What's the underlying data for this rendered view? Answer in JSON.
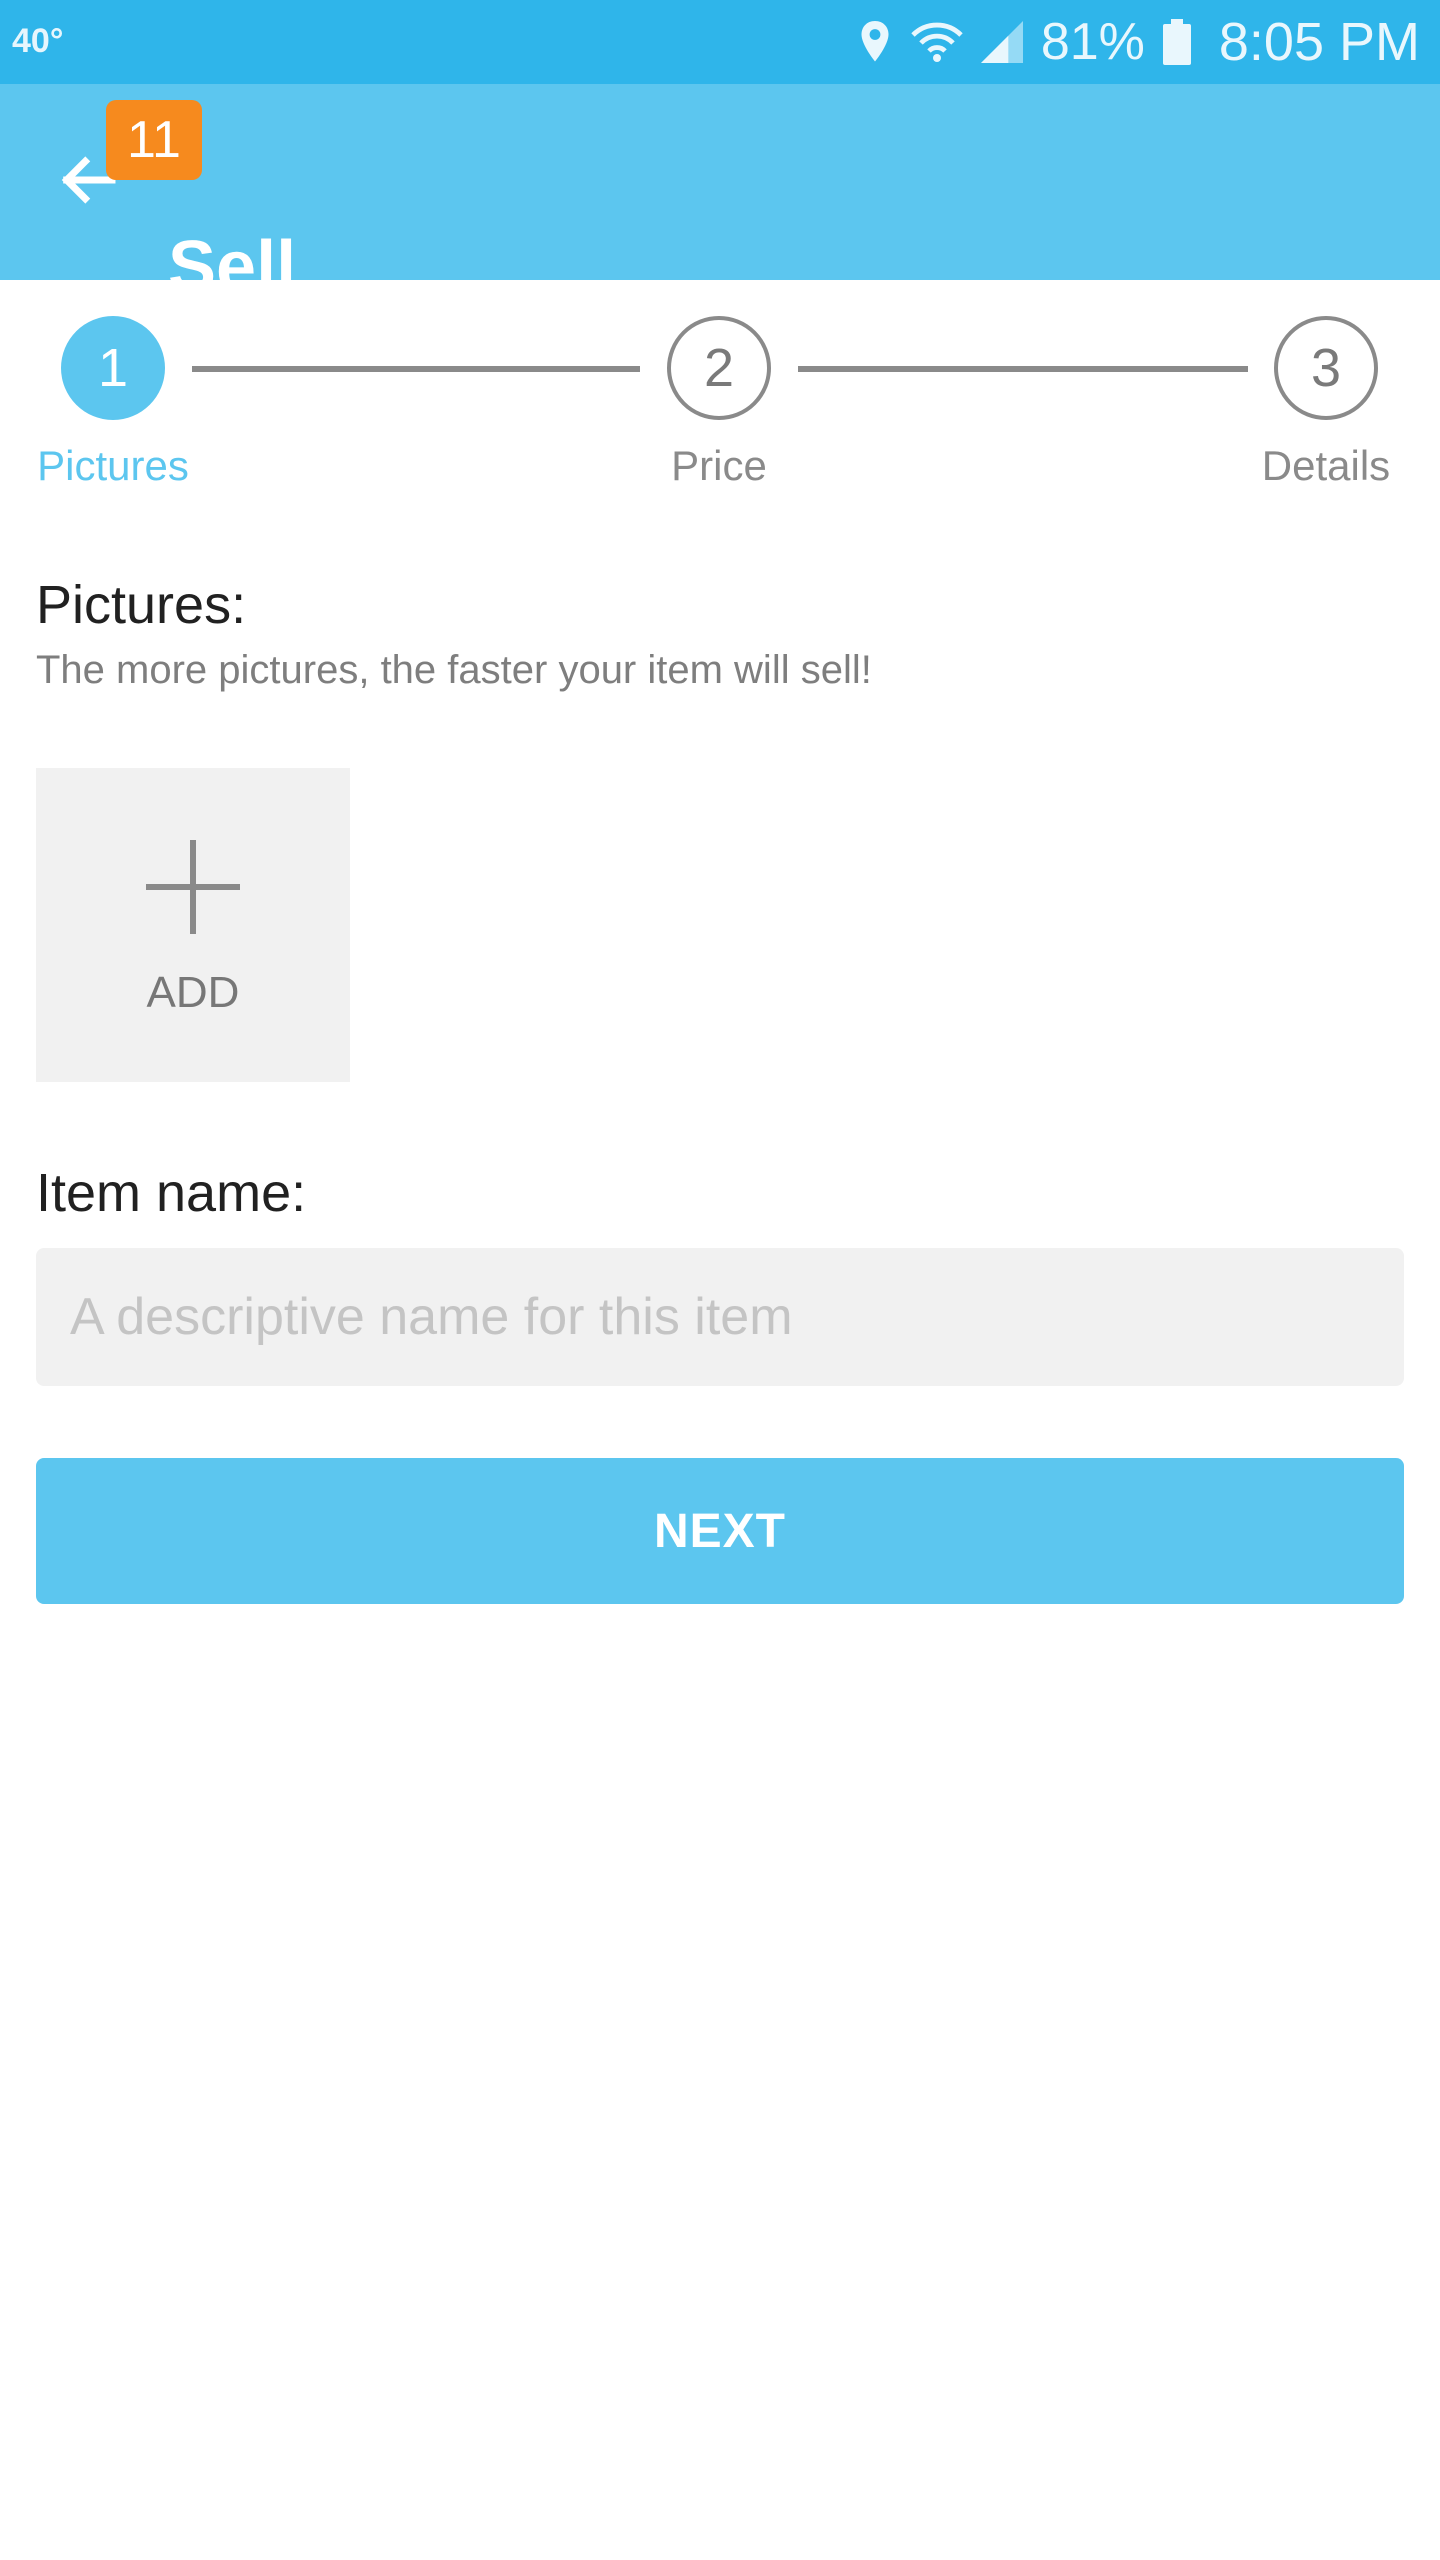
{
  "status_bar": {
    "temperature": "40°",
    "battery_percent": "81%",
    "time": "8:05 PM"
  },
  "app_bar": {
    "title": "Sell",
    "notification_count": "11"
  },
  "stepper": {
    "active_step": 1,
    "steps": [
      {
        "number": "1",
        "label": "Pictures"
      },
      {
        "number": "2",
        "label": "Price"
      },
      {
        "number": "3",
        "label": "Details"
      }
    ]
  },
  "pictures_section": {
    "title": "Pictures:",
    "subtitle": "The more pictures, the faster your item will sell!",
    "add_label": "ADD"
  },
  "item_name_section": {
    "title": "Item name:",
    "placeholder": "A descriptive name for this item",
    "value": ""
  },
  "next_button": {
    "label": "NEXT"
  },
  "colors": {
    "status_bar": "#2fb5ea",
    "app_bar": "#5cc6ef",
    "accent": "#5cc6ef",
    "badge": "#f68a1e"
  }
}
